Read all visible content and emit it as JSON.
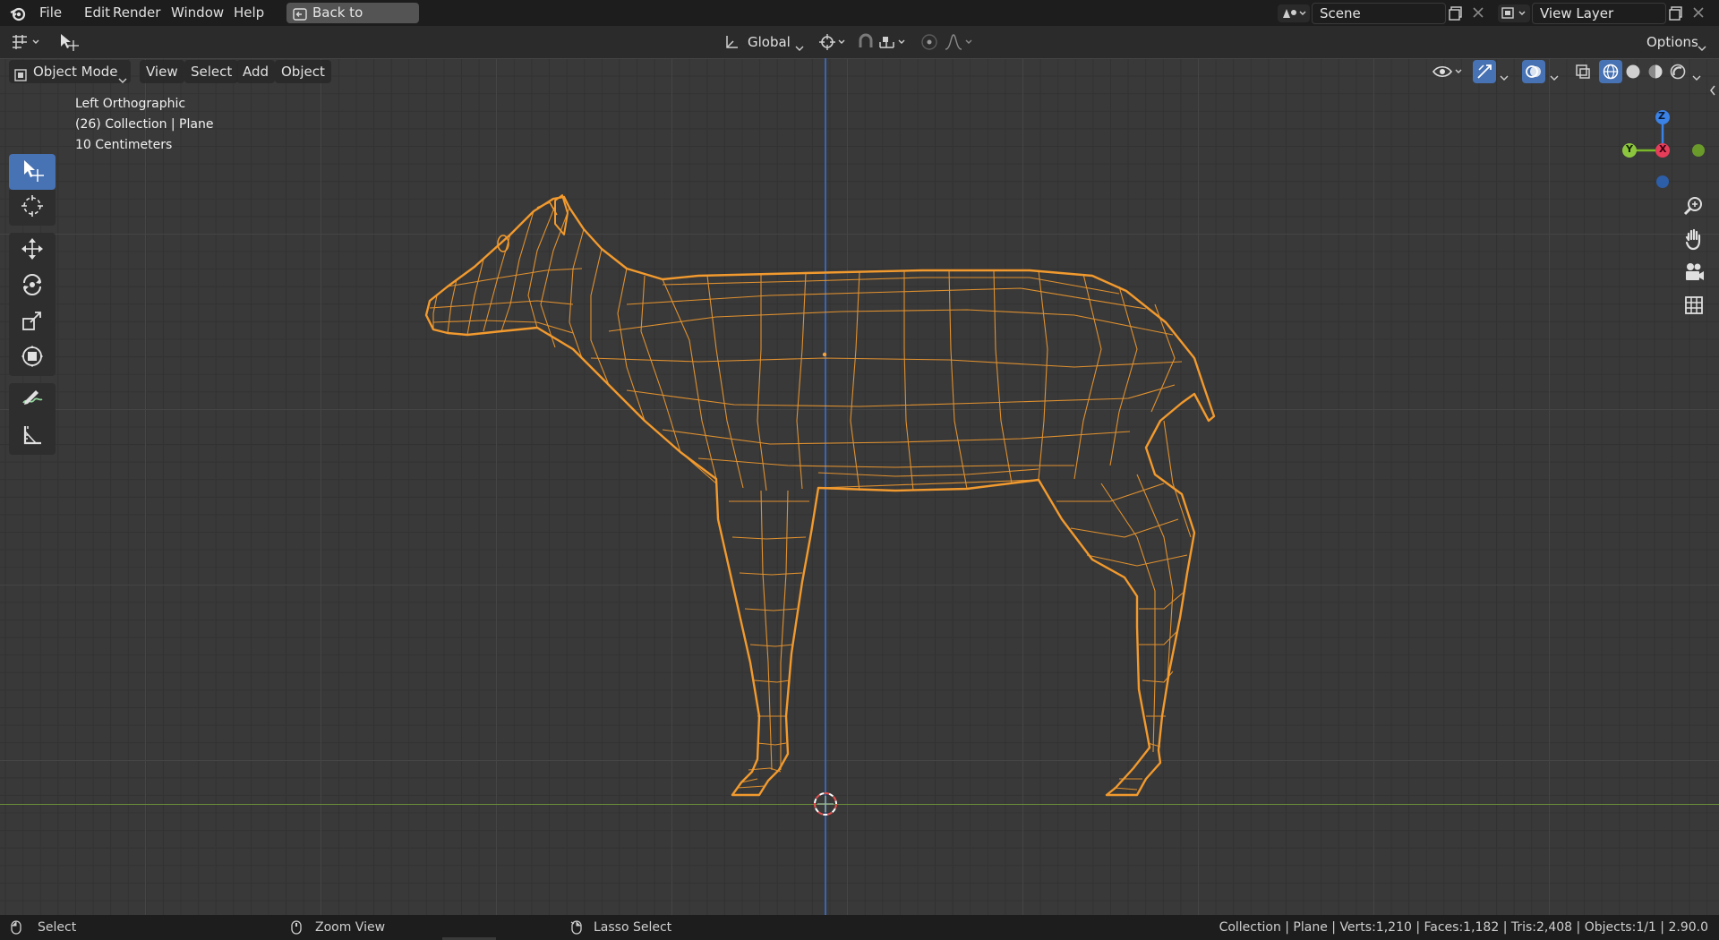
{
  "topbar": {
    "menus": [
      "File",
      "Edit",
      "Render",
      "Window",
      "Help"
    ],
    "back_button": "Back to Previous",
    "scene_name": "Scene",
    "view_layer_name": "View Layer"
  },
  "tool_header": {
    "transform_orientation": "Global",
    "options_label": "Options"
  },
  "view_header": {
    "mode": "Object Mode",
    "menus": [
      "View",
      "Select",
      "Add",
      "Object"
    ]
  },
  "viewport": {
    "view_name": "Left Orthographic",
    "collection_info": "(26) Collection | Plane",
    "scale_info": "10 Centimeters",
    "gizmo_axes": {
      "z": "Z",
      "y": "Y",
      "x": "X"
    },
    "colors": {
      "selection": "#f29a2e",
      "grid_x_axis": "#6b8f3a",
      "grid_z_axis": "#3a6fc9",
      "active_tool": "#4772b3"
    }
  },
  "toolbar": {
    "tools": [
      "select-box-icon",
      "cursor-icon",
      "move-icon",
      "rotate-icon",
      "scale-icon",
      "transform-icon",
      "annotate-icon",
      "measure-icon"
    ]
  },
  "statusbar": {
    "left_action": "Select",
    "middle_action": "Zoom View",
    "right_action": "Lasso Select",
    "stats": "Collection | Plane | Verts:1,210 | Faces:1,182 | Tris:2,408 | Objects:1/1 | 2.90.0"
  }
}
